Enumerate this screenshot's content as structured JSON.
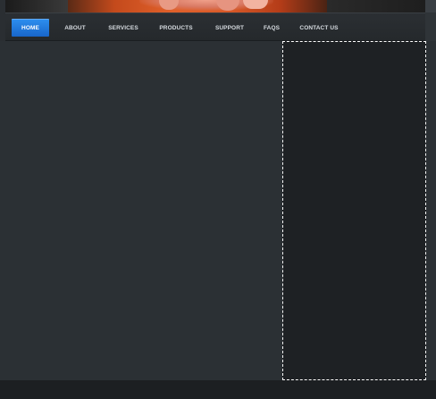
{
  "nav": {
    "items": [
      {
        "label": "HOME",
        "active": true
      },
      {
        "label": "ABOUT",
        "active": false
      },
      {
        "label": "SERVICES",
        "active": false
      },
      {
        "label": "PRODUCTS",
        "active": false
      },
      {
        "label": "SUPPORT",
        "active": false
      },
      {
        "label": "FAQS",
        "active": false
      },
      {
        "label": "CONTACT US",
        "active": false
      }
    ]
  },
  "colors": {
    "accent": "#1f7ae0",
    "background": "#2a2e32",
    "sidebar_background": "#1e2124",
    "footer_background": "#1c1f22"
  }
}
